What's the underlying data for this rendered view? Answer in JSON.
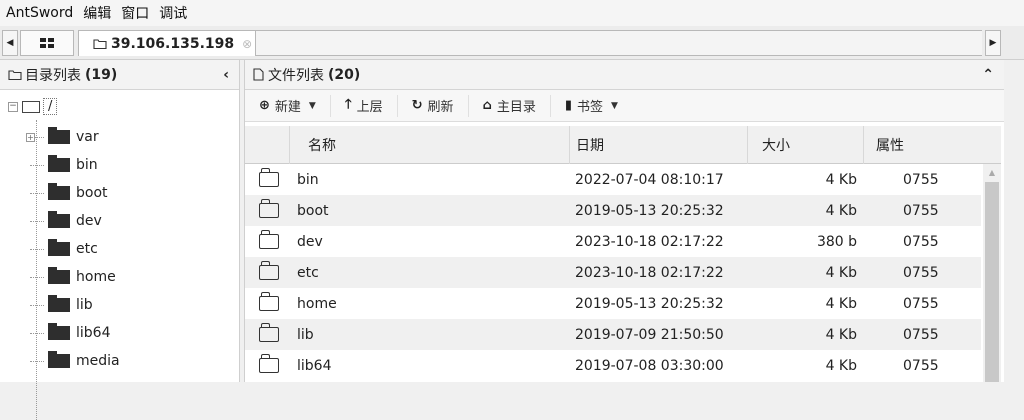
{
  "menu": [
    "AntSword",
    "编辑",
    "窗口",
    "调试"
  ],
  "tabs": {
    "home_icon": "grid-icon",
    "active_label": "39.106.135.198",
    "close_glyph": "⊗"
  },
  "left_panel": {
    "title": "目录列表",
    "count": "(19)",
    "root_label": "/",
    "items": [
      "var",
      "bin",
      "boot",
      "dev",
      "etc",
      "home",
      "lib",
      "lib64",
      "media"
    ]
  },
  "right_panel": {
    "title": "文件列表",
    "count": "(20)",
    "toolbar": {
      "new": "新建",
      "up": "上层",
      "refresh": "刷新",
      "home": "主目录",
      "bookmarks": "书签"
    },
    "columns": {
      "name": "名称",
      "date": "日期",
      "size": "大小",
      "attr": "属性"
    },
    "rows": [
      {
        "name": "bin",
        "date": "2022-07-04 08:10:17",
        "size": "4 Kb",
        "attr": "0755"
      },
      {
        "name": "boot",
        "date": "2019-05-13 20:25:32",
        "size": "4 Kb",
        "attr": "0755"
      },
      {
        "name": "dev",
        "date": "2023-10-18 02:17:22",
        "size": "380 b",
        "attr": "0755"
      },
      {
        "name": "etc",
        "date": "2023-10-18 02:17:22",
        "size": "4 Kb",
        "attr": "0755"
      },
      {
        "name": "home",
        "date": "2019-05-13 20:25:32",
        "size": "4 Kb",
        "attr": "0755"
      },
      {
        "name": "lib",
        "date": "2019-07-09 21:50:50",
        "size": "4 Kb",
        "attr": "0755"
      },
      {
        "name": "lib64",
        "date": "2019-07-08 03:30:00",
        "size": "4 Kb",
        "attr": "0755"
      }
    ]
  }
}
